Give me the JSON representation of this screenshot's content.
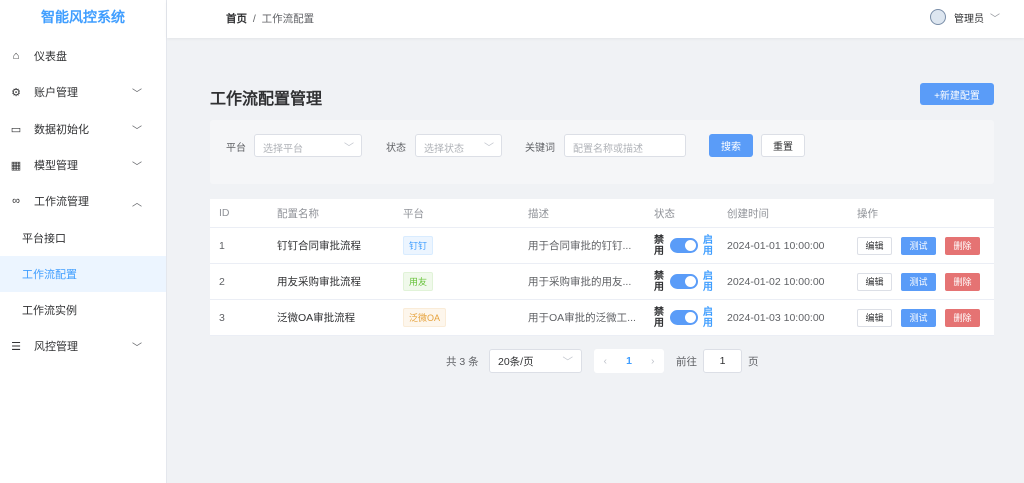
{
  "app_title": "智能风控系统",
  "sidebar": {
    "items": [
      {
        "label": "仪表盘",
        "icon": "home-icon"
      },
      {
        "label": "账户管理",
        "icon": "gear-icon"
      },
      {
        "label": "数据初始化",
        "icon": "chart-icon"
      },
      {
        "label": "模型管理",
        "icon": "grid-icon"
      },
      {
        "label": "工作流管理",
        "icon": "link-icon"
      },
      {
        "label": "平台接口"
      },
      {
        "label": "工作流配置"
      },
      {
        "label": "工作流实例"
      },
      {
        "label": "风控管理",
        "icon": "sliders-icon"
      }
    ]
  },
  "header": {
    "breadcrumb": [
      "首页",
      "工作流配置"
    ],
    "user": "管理员"
  },
  "page": {
    "title": "工作流配置管理",
    "new_button": "+新建配置"
  },
  "filter": {
    "platform_label": "平台",
    "platform_placeholder": "选择平台",
    "status_label": "状态",
    "status_placeholder": "选择状态",
    "keyword_label": "关键词",
    "keyword_placeholder": "配置名称或描述",
    "search": "搜索",
    "reset": "重置"
  },
  "table": {
    "columns": [
      "ID",
      "配置名称",
      "平台",
      "描述",
      "状态",
      "创建时间",
      "操作"
    ],
    "rows": [
      {
        "id": "1",
        "name": "钉钉合同审批流程",
        "platform": "钉钉",
        "desc": "用于合同审批的钉钉...",
        "off": "禁用",
        "on": "启用",
        "created": "2024-01-01 10:00:00"
      },
      {
        "id": "2",
        "name": "用友采购审批流程",
        "platform": "用友",
        "desc": "用于采购审批的用友...",
        "off": "禁用",
        "on": "启用",
        "created": "2024-01-02 10:00:00"
      },
      {
        "id": "3",
        "name": "泛微OA审批流程",
        "platform": "泛微OA",
        "desc": "用于OA审批的泛微工...",
        "off": "禁用",
        "on": "启用",
        "created": "2024-01-03 10:00:00"
      }
    ],
    "actions": {
      "edit": "编辑",
      "test": "测试",
      "delete": "删除"
    }
  },
  "pagination": {
    "total": "共 3 条",
    "page_size": "20条/页",
    "current": "1",
    "goto": "前往",
    "goto_value": "1",
    "page_suffix": "页"
  }
}
